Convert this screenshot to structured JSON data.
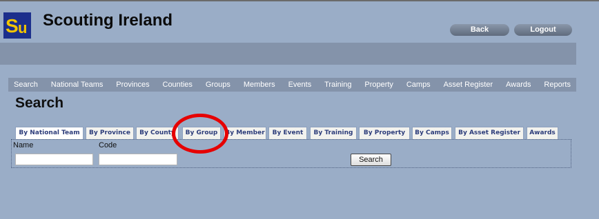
{
  "header": {
    "logo_text": "SI",
    "title": "Scouting Ireland",
    "back_label": "Back",
    "logout_label": "Logout"
  },
  "nav": {
    "items": [
      "Search",
      "National Teams",
      "Provinces",
      "Counties",
      "Groups",
      "Members",
      "Events",
      "Training",
      "Property",
      "Camps",
      "Asset Register",
      "Awards",
      "Reports"
    ]
  },
  "main": {
    "title": "Search",
    "tabs": [
      "By National Team",
      "By Province",
      "By County",
      "By Group",
      "By Member",
      "By Event",
      "By Training",
      "By Property",
      "By Camps",
      "By Asset Register",
      "Awards"
    ],
    "active_tab": "By National Team",
    "form": {
      "name_label": "Name",
      "code_label": "Code",
      "name_value": "",
      "code_value": "",
      "search_label": "Search"
    }
  },
  "annotation": {
    "highlight_color": "#e60000",
    "highlighted_tab": "By Group"
  }
}
